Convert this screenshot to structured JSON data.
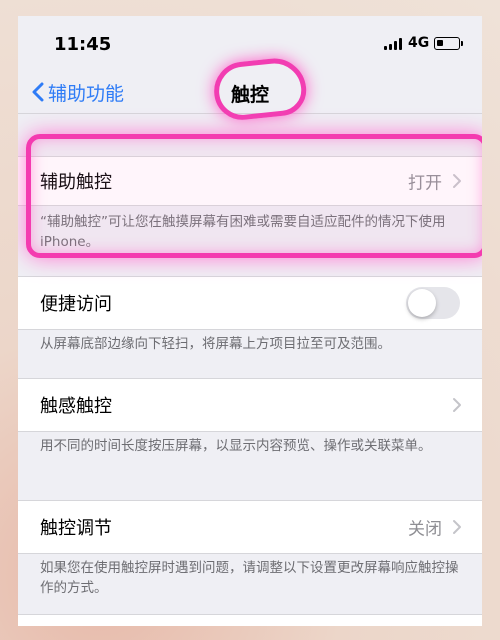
{
  "status_bar": {
    "time": "11:45",
    "network": "4G"
  },
  "nav": {
    "back_label": "辅助功能",
    "title": "触控"
  },
  "sections": {
    "assistive_touch": {
      "label": "辅助触控",
      "value": "打开",
      "footer": "“辅助触控”可让您在触摸屏幕有困难或需要自适应配件的情况下使用iPhone。"
    },
    "reachability": {
      "label": "便捷访问",
      "toggle_on": false,
      "footer": "从屏幕底部边缘向下轻扫，将屏幕上方项目拉至可及范围。"
    },
    "haptic_touch": {
      "label": "触感触控",
      "footer": "用不同的时间长度按压屏幕，以显示内容预览、操作或关联菜单。"
    },
    "touch_accommodations": {
      "label": "触控调节",
      "value": "关闭",
      "footer": "如果您在使用触控屏时遇到问题，请调整以下设置更改屏幕响应触控操作的方式。"
    }
  },
  "colors": {
    "accent": "#2f7cf6",
    "highlight": "#f43bb0"
  }
}
